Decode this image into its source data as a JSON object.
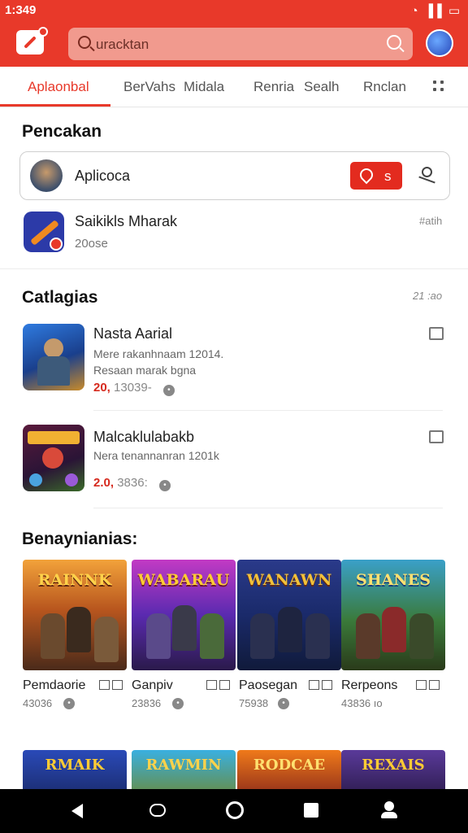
{
  "status_bar": {
    "time": "1:349"
  },
  "header": {
    "search_placeholder": "uracktan"
  },
  "tabs": [
    {
      "label": "Aplaonbal",
      "active": true
    },
    {
      "label": "BerVahs"
    },
    {
      "label": "Midala"
    },
    {
      "label": "Renria"
    },
    {
      "label": "Sealh"
    },
    {
      "label": "Rnclan"
    }
  ],
  "search_section": {
    "title": "Pencakan",
    "app_name": "Aplicoca",
    "action_label": "s",
    "featured": {
      "name": "Saikikls Mharak",
      "sub": "20ose",
      "right": "#atih"
    }
  },
  "categories": {
    "title": "Catlagias",
    "right_label": "21 :ao",
    "items": [
      {
        "title": "Nasta Aarial",
        "desc1": "Mere rakanhnaam 12014.",
        "desc2": "Resaan marak bgna",
        "price_red": "20,",
        "price": "13039-"
      },
      {
        "title": "Malcaklulabakb",
        "desc1": "Nera tenannanran 1201k",
        "price_red": "2.0,",
        "price": "3836:"
      }
    ]
  },
  "recommendations": {
    "title": "Benaynianias:",
    "items": [
      {
        "tile_title": "RAINNK",
        "name": "Pemdaorie",
        "price": "43036"
      },
      {
        "tile_title": "WABARAU",
        "name": "Ganpiv",
        "price": "23836"
      },
      {
        "tile_title": "WANAWN",
        "name": "Paosegan",
        "price": "75938"
      },
      {
        "tile_title": "SHANES",
        "name": "Rerpeons",
        "price": "43836 ıo"
      }
    ],
    "row2": [
      {
        "tile_title": "RMAIK"
      },
      {
        "tile_title": "RAWMIN"
      },
      {
        "tile_title": "RODCAE"
      },
      {
        "tile_title": "REXAIS"
      }
    ]
  },
  "colors": {
    "accent": "#e8392a",
    "price_red": "#d62a1e"
  }
}
